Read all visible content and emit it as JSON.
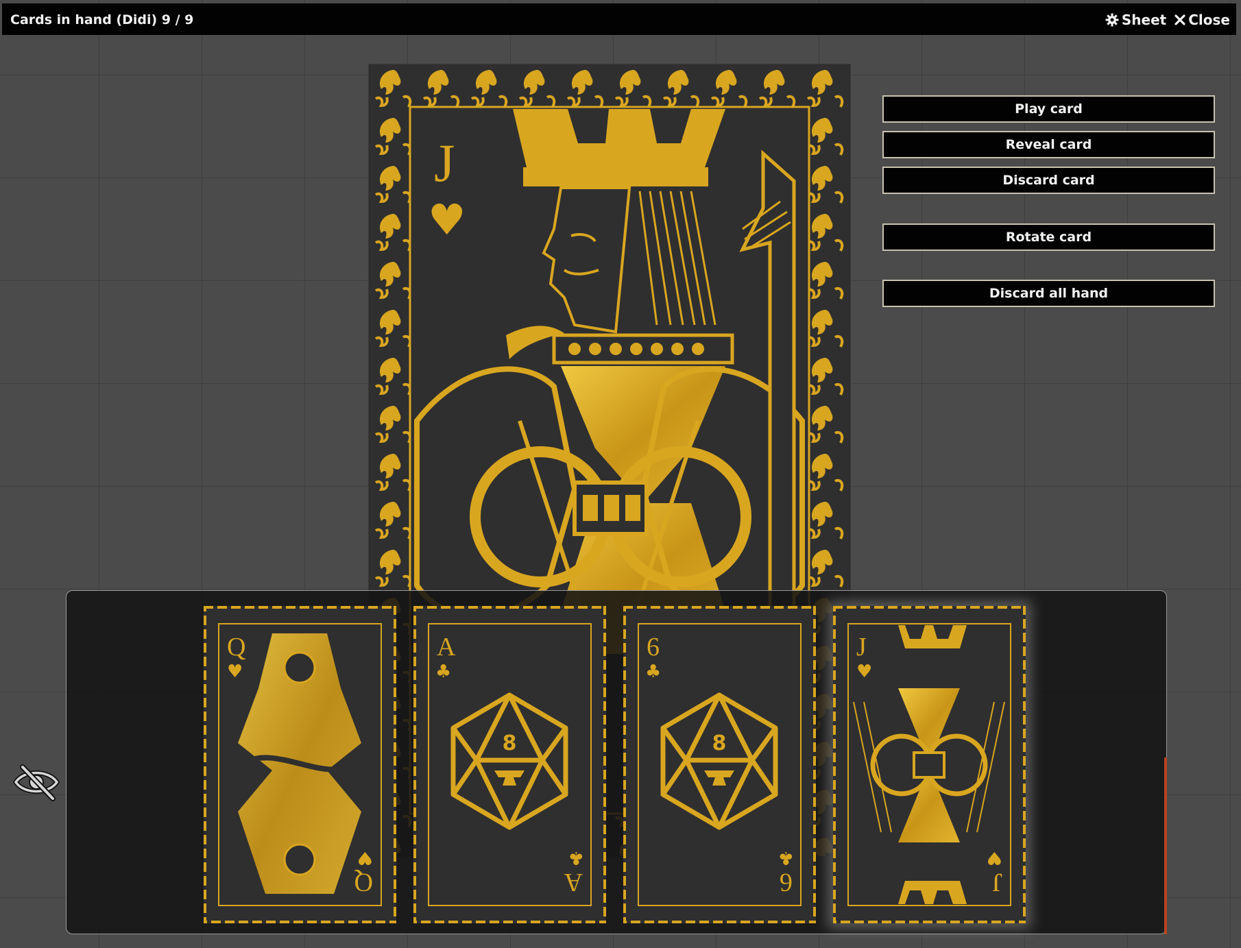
{
  "window": {
    "title": "Cards in hand (Didi) 9 / 9",
    "actions": [
      {
        "label": "Sheet",
        "icon": "gear-icon"
      },
      {
        "label": "Close",
        "icon": "close-icon"
      }
    ]
  },
  "preview_card": {
    "rank": "J",
    "suit": "hearts",
    "suit_symbol": "♥",
    "face": "jack-of-hearts"
  },
  "buttons": {
    "play": "Play card",
    "reveal": "Reveal card",
    "discard": "Discard card",
    "rotate": "Rotate card",
    "discard_all": "Discard all hand"
  },
  "hand": {
    "cards": [
      {
        "rank": "Q",
        "suit_symbol": "♥",
        "face": "queen-of-hearts",
        "selected": false
      },
      {
        "rank": "A",
        "suit_symbol": "♣",
        "face": "ace-of-clubs",
        "die_number": "8",
        "selected": false
      },
      {
        "rank": "6",
        "suit_symbol": "♣",
        "face": "six-of-clubs",
        "die_number": "8",
        "selected": false
      },
      {
        "rank": "J",
        "suit_symbol": "♥",
        "face": "jack-of-hearts",
        "selected": true
      }
    ]
  },
  "colors": {
    "gold": "#d9a620",
    "card_bg": "#2f2f2f",
    "accent": "#b7441f"
  }
}
